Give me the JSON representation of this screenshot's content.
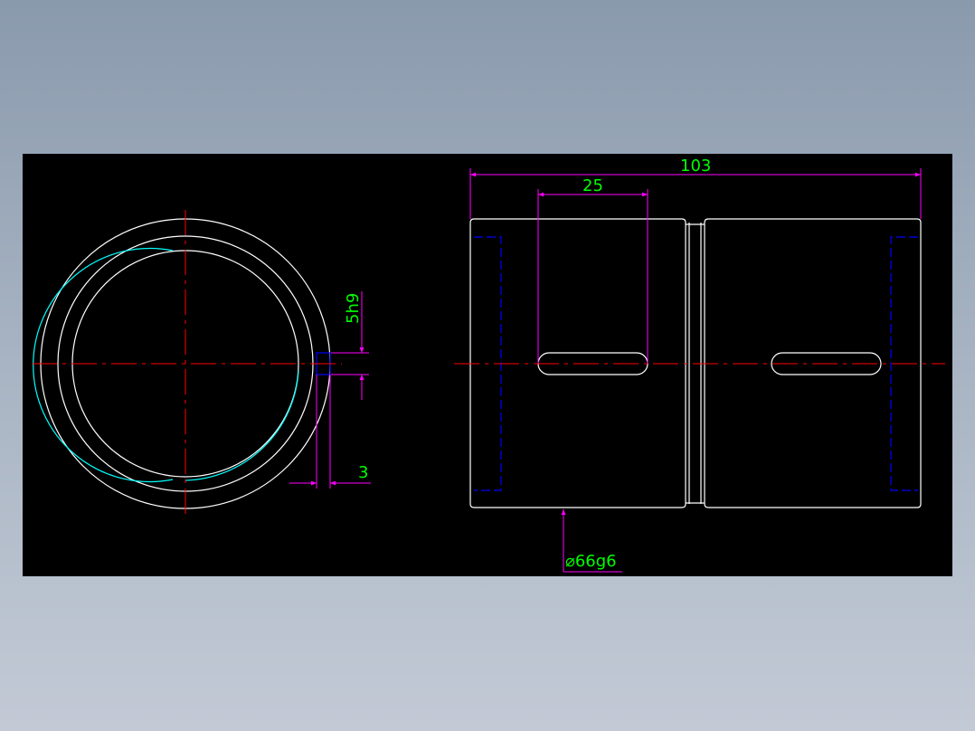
{
  "colors": {
    "background_gradient_top": "#8a9aad",
    "background_gradient_bottom": "#c3cad6",
    "canvas": "#000000",
    "outline": "#ffffff",
    "centerline": "#ff0000",
    "dimension": "#ff00ff",
    "dimension_text": "#00ff00",
    "hidden_line": "#0000ff",
    "thread_arc": "#00ffff"
  },
  "dimensions": {
    "overall_length": "103",
    "slot_length": "25",
    "keyway_width": "5h9",
    "keyway_depth": "3",
    "outer_diameter": "⌀66g6"
  }
}
